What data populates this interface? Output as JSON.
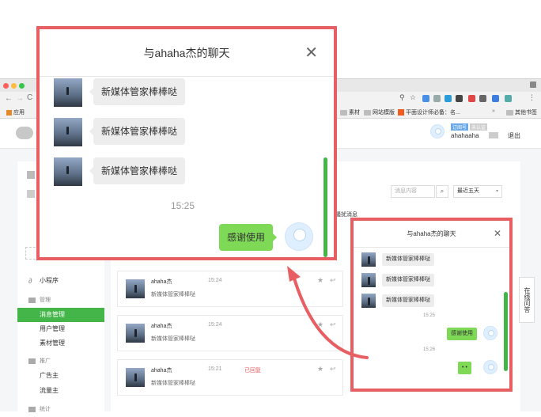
{
  "browser": {
    "bookmarks": {
      "apps": "应用",
      "items": [
        "素材",
        "网站模版",
        "平面设计师必备：名..."
      ],
      "other": "其他书签"
    },
    "header": {
      "tag1": "订阅号",
      "tag2": "未认证",
      "username": "ahahaaha",
      "logout": "退出"
    },
    "sidebar": {
      "items": [
        {
          "label": "小程序",
          "icon": "mini-program-icon"
        },
        {
          "label": "管理",
          "icon": "manage-icon"
        },
        {
          "label": "消息管理",
          "active": true
        },
        {
          "label": "用户管理"
        },
        {
          "label": "素材管理"
        },
        {
          "label": "推广",
          "icon": "promote-icon"
        },
        {
          "label": "广告主"
        },
        {
          "label": "流量主"
        },
        {
          "label": "统计",
          "icon": "stats-icon"
        }
      ],
      "accent": "#44b549"
    },
    "content": {
      "search_placeholder": "消息内容",
      "range": "最近五天",
      "filter_label": "隐藏骚扰消息",
      "messages": [
        {
          "name": "ahaha杰",
          "text": "新媒体管家棒棒哒",
          "time": "15:24",
          "status": ""
        },
        {
          "name": "ahaha杰",
          "text": "新媒体管家棒棒哒",
          "time": "15:24",
          "status": ""
        },
        {
          "name": "ahaha杰",
          "text": "新媒体管家棒棒哒",
          "time": "15:21",
          "status": "已回复"
        }
      ]
    }
  },
  "big_popup": {
    "title": "与ahaha杰的聊天",
    "messages": [
      {
        "from": "them",
        "text": "新媒体管家棒棒哒"
      },
      {
        "from": "them",
        "text": "新媒体管家棒棒哒"
      },
      {
        "from": "them",
        "text": "新媒体管家棒棒哒"
      }
    ],
    "time": "15:25",
    "reply": "感谢使用",
    "border_color": "#e85f63",
    "scroll_color": "#44b549"
  },
  "small_popup": {
    "title": "与ahaha杰的聊天",
    "messages": [
      {
        "from": "them",
        "text": "新媒体管家棒棒哒"
      },
      {
        "from": "them",
        "text": "新媒体管家棒棒哒"
      },
      {
        "from": "them",
        "text": "新媒体管家棒棒哒"
      }
    ],
    "time1": "15:25",
    "reply": "感谢使用",
    "time2": "15:26",
    "reply2": "• •"
  },
  "online_tab": "在线问答"
}
